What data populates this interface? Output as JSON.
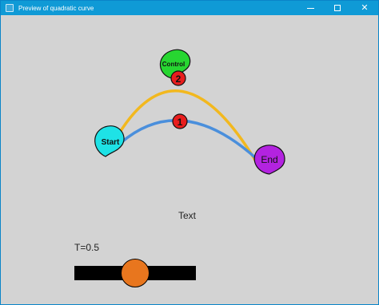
{
  "window": {
    "title": "Preview of quadratic curve"
  },
  "labels": {
    "start": "Start",
    "control": "Control",
    "end": "End",
    "marker_curve": "1",
    "marker_control": "2",
    "text": "Text",
    "t_label": "T=0.5"
  },
  "slider": {
    "value": 0.5
  },
  "colors": {
    "titlebar": "#0f9ad6",
    "start_marker": "#1ee2e6",
    "control_marker": "#27d631",
    "end_marker": "#b323e0",
    "point_marker": "#e81e1e",
    "control_polyline": "#f2b81e",
    "quadratic_curve": "#4a8fdc",
    "slider_knob": "#e8761e",
    "slider_track": "#000000"
  },
  "icons": {
    "app": "app-icon",
    "minimize": "minimize-icon",
    "maximize": "maximize-icon",
    "close": "close-icon"
  }
}
